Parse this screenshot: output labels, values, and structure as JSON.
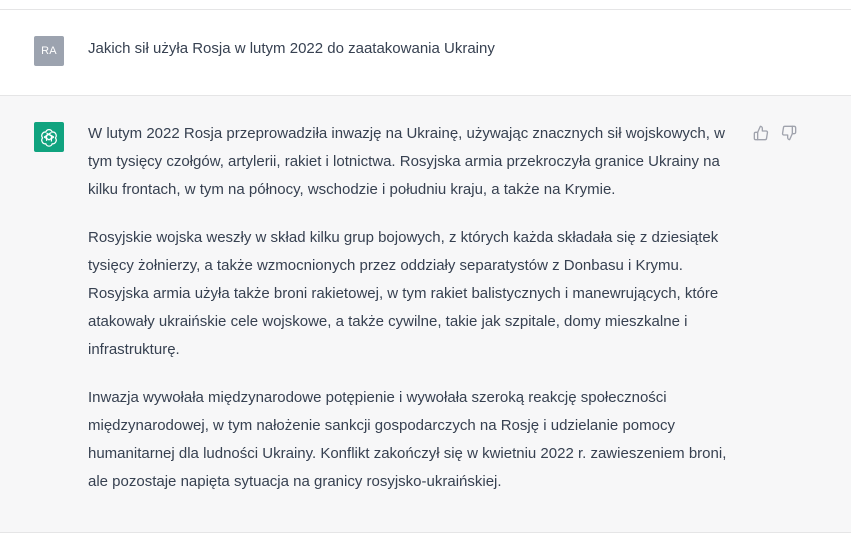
{
  "user_message": {
    "avatar_initials": "RA",
    "text": "Jakich sił użyła Rosja w lutym 2022 do zaatakowania Ukrainy"
  },
  "assistant_message": {
    "paragraphs": [
      "W lutym 2022 Rosja przeprowadziła inwazję na Ukrainę, używając znacznych sił wojskowych, w tym tysięcy czołgów, artylerii, rakiet i lotnictwa. Rosyjska armia przekroczyła granice Ukrainy na kilku frontach, w tym na północy, wschodzie i południu kraju, a także na Krymie.",
      "Rosyjskie wojska weszły w skład kilku grup bojowych, z których każda składała się z dziesiątek tysięcy żołnierzy, a także wzmocnionych przez oddziały separatystów z Donbasu i Krymu. Rosyjska armia użyła także broni rakietowej, w tym rakiet balistycznych i manewrujących, które atakowały ukraińskie cele wojskowe, a także cywilne, takie jak szpitale, domy mieszkalne i infrastrukturę.",
      "Inwazja wywołała międzynarodowe potępienie i wywołała szeroką reakcję społeczności międzynarodowej, w tym nałożenie sankcji gospodarczych na Rosję i udzielanie pomocy humanitarnej dla ludności Ukrainy. Konflikt zakończył się w kwietniu 2022 r. zawieszeniem broni, ale pozostaje napięta sytuacja na granicy rosyjsko-ukraińskiej."
    ]
  },
  "icons": {
    "assistant_logo": "openai-logo-icon",
    "thumbs_up": "thumbs-up-icon",
    "thumbs_down": "thumbs-down-icon"
  },
  "colors": {
    "assistant_avatar_bg": "#10a37f",
    "user_avatar_bg": "#9ca3af",
    "assistant_row_bg": "#f7f7f8",
    "text": "#374151"
  }
}
